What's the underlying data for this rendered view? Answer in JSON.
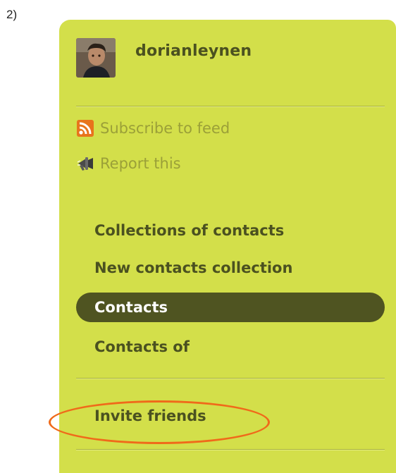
{
  "step": "2)",
  "profile": {
    "username": "dorianleynen",
    "avatar_icon": "user-avatar"
  },
  "actions": [
    {
      "label": "Subscribe to feed",
      "icon": "rss-feed-icon",
      "color": "#9ba038"
    },
    {
      "label": "Report this",
      "icon": "megaphone-icon",
      "color": "#9ba038"
    }
  ],
  "nav": {
    "items": [
      {
        "label": "Collections of contacts",
        "active": false
      },
      {
        "label": "New contacts collection",
        "active": false
      },
      {
        "label": "Contacts",
        "active": true
      },
      {
        "label": "Contacts of",
        "active": false
      }
    ],
    "invite": {
      "label": "Invite friends",
      "highlighted": true
    }
  },
  "colors": {
    "panel": "#d3df4a",
    "text_dark": "#4b5120",
    "active_bg": "#4f5421",
    "highlight": "#f06a1a"
  }
}
